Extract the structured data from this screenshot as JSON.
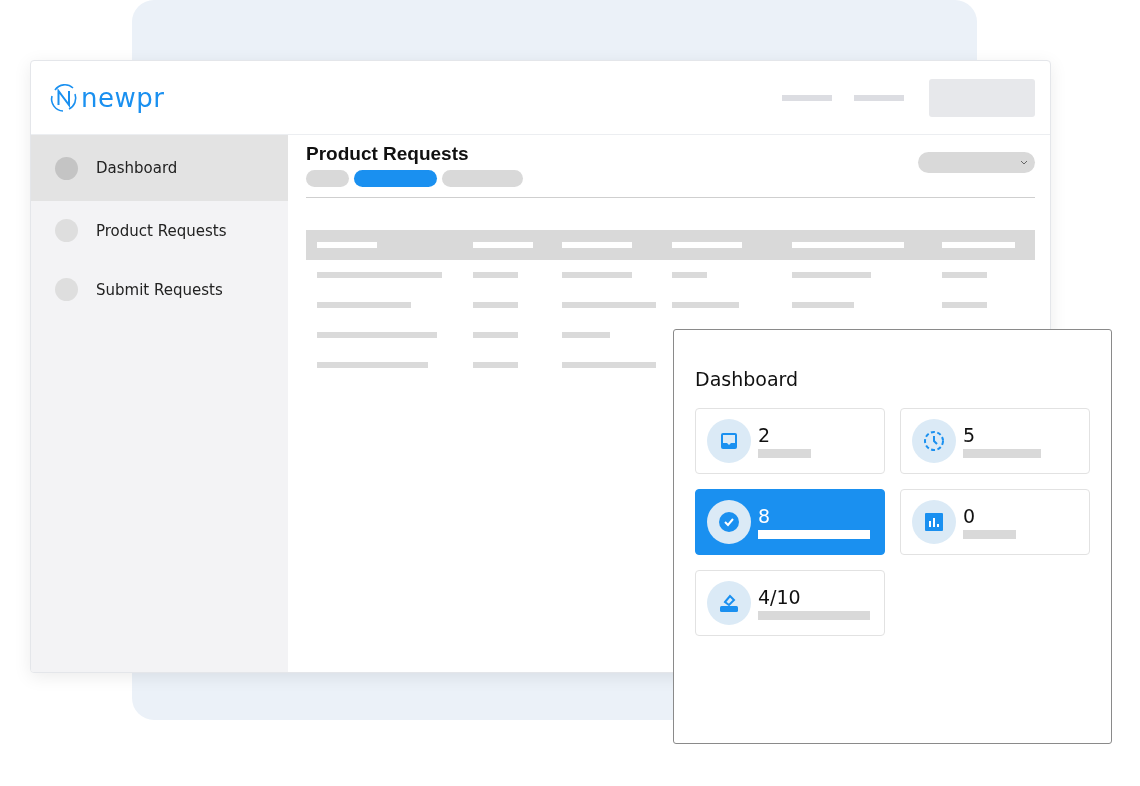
{
  "logo": {
    "text": "newpr"
  },
  "sidebar": {
    "items": [
      {
        "label": "Dashboard",
        "selected": true
      },
      {
        "label": "Product Requests",
        "selected": false
      },
      {
        "label": "Submit Requests",
        "selected": false
      }
    ]
  },
  "page": {
    "title": "Product Requests",
    "tabs": [
      {
        "selected": false
      },
      {
        "selected": true
      },
      {
        "selected": false
      }
    ]
  },
  "dashboard": {
    "title": "Dashboard",
    "stats": [
      {
        "value": "2",
        "kind": "inbox",
        "selected": false
      },
      {
        "value": "5",
        "kind": "clock",
        "selected": false
      },
      {
        "value": "8",
        "kind": "check",
        "selected": true
      },
      {
        "value": "0",
        "kind": "chart",
        "selected": false
      },
      {
        "value": "4/10",
        "kind": "stamp",
        "selected": false
      }
    ]
  }
}
